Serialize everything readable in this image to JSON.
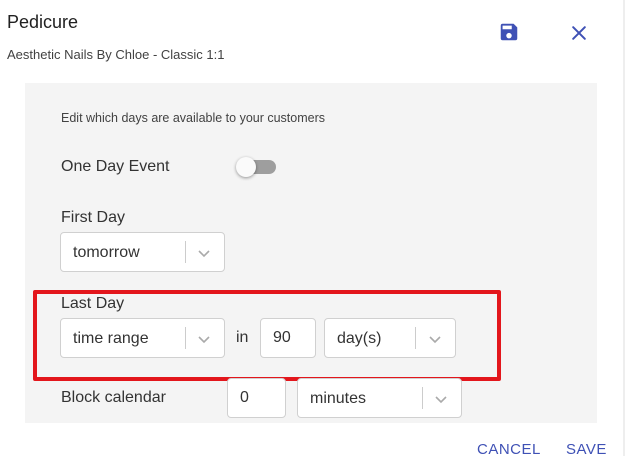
{
  "dialog": {
    "title": "Pedicure",
    "subtitle": "Aesthetic Nails By Chloe - Classic 1:1"
  },
  "form": {
    "instructions": "Edit which days are available to your customers",
    "one_day_event": {
      "label": "One Day Event",
      "enabled": false
    },
    "first_day": {
      "label": "First Day",
      "value": "tomorrow"
    },
    "last_day": {
      "label": "Last Day",
      "mode": "time range",
      "connector": "in",
      "amount": "90",
      "unit": "day(s)"
    },
    "block_calendar": {
      "label": "Block calendar",
      "amount": "0",
      "unit": "minutes"
    }
  },
  "actions": {
    "cancel_label": "CANCEL",
    "save_label": "SAVE"
  },
  "icons": {
    "save": "floppy-disk-icon",
    "close": "close-icon",
    "chevron": "chevron-down-icon"
  },
  "colors": {
    "accent": "#3f51b5",
    "highlight": "#e3161c",
    "panel": "#f4f4f4"
  }
}
